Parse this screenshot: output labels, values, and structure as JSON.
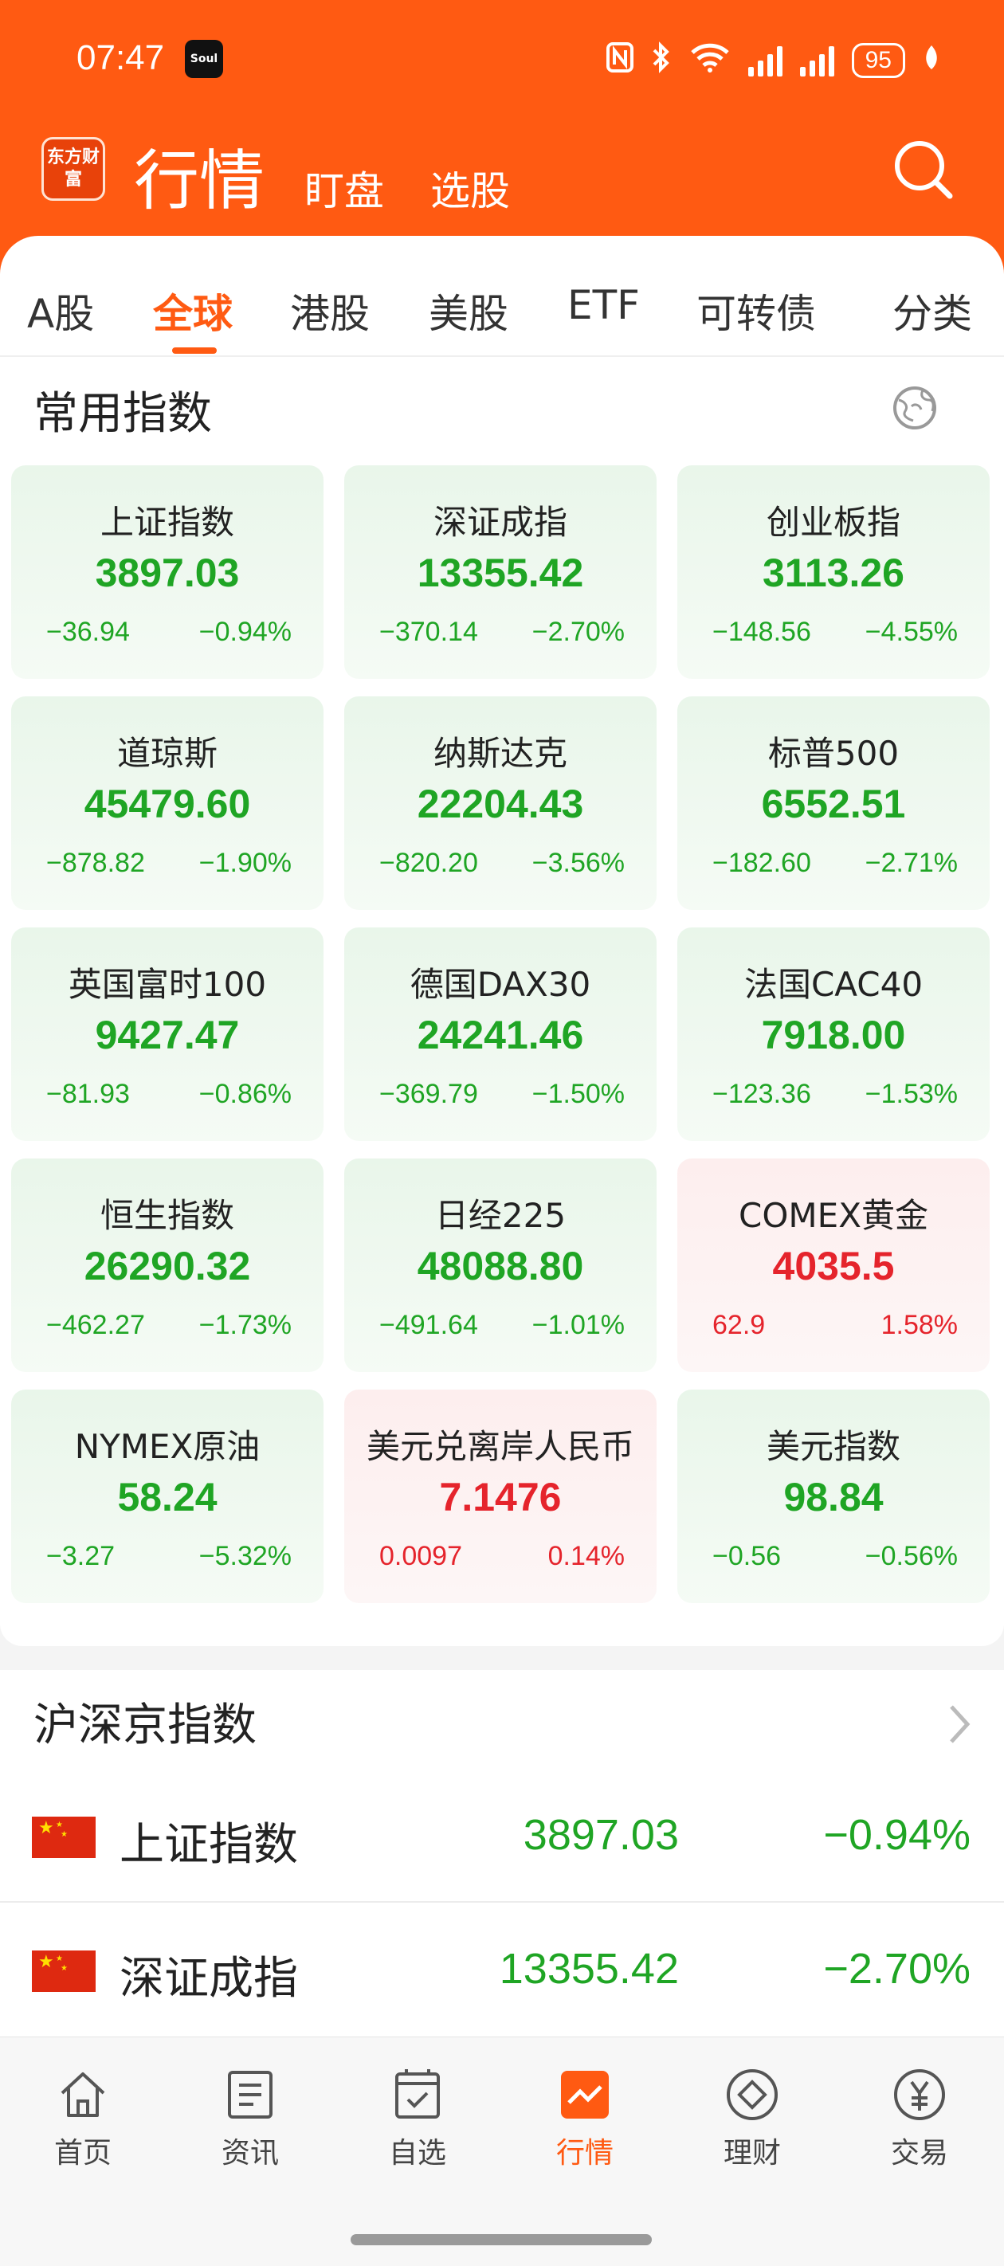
{
  "status_bar": {
    "time": "07:47",
    "app_icon": "Soul",
    "battery": "95",
    "icons": [
      "nfc-icon",
      "bluetooth-icon",
      "wifi-icon",
      "signal-icon",
      "signal-icon",
      "battery-icon",
      "leaf-icon"
    ]
  },
  "header": {
    "logo_text": "东方财富",
    "title": "行情",
    "nav": [
      "盯盘",
      "选股"
    ]
  },
  "tabs": [
    "A股",
    "全球",
    "港股",
    "美股",
    "ETF",
    "可转债",
    "分类"
  ],
  "active_tab": "全球",
  "common_indices": {
    "title": "常用指数",
    "cards": [
      {
        "name": "上证指数",
        "price": "3897.03",
        "change": "−36.94",
        "pct": "−0.94%",
        "trend": "down"
      },
      {
        "name": "深证成指",
        "price": "13355.42",
        "change": "−370.14",
        "pct": "−2.70%",
        "trend": "down"
      },
      {
        "name": "创业板指",
        "price": "3113.26",
        "change": "−148.56",
        "pct": "−4.55%",
        "trend": "down"
      },
      {
        "name": "道琼斯",
        "price": "45479.60",
        "change": "−878.82",
        "pct": "−1.90%",
        "trend": "down"
      },
      {
        "name": "纳斯达克",
        "price": "22204.43",
        "change": "−820.20",
        "pct": "−3.56%",
        "trend": "down"
      },
      {
        "name": "标普500",
        "price": "6552.51",
        "change": "−182.60",
        "pct": "−2.71%",
        "trend": "down"
      },
      {
        "name": "英国富时100",
        "price": "9427.47",
        "change": "−81.93",
        "pct": "−0.86%",
        "trend": "down"
      },
      {
        "name": "德国DAX30",
        "price": "24241.46",
        "change": "−369.79",
        "pct": "−1.50%",
        "trend": "down"
      },
      {
        "name": "法国CAC40",
        "price": "7918.00",
        "change": "−123.36",
        "pct": "−1.53%",
        "trend": "down"
      },
      {
        "name": "恒生指数",
        "price": "26290.32",
        "change": "−462.27",
        "pct": "−1.73%",
        "trend": "down"
      },
      {
        "name": "日经225",
        "price": "48088.80",
        "change": "−491.64",
        "pct": "−1.01%",
        "trend": "down"
      },
      {
        "name": "COMEX黄金",
        "price": "4035.5",
        "change": "62.9",
        "pct": "1.58%",
        "trend": "up"
      },
      {
        "name": "NYMEX原油",
        "price": "58.24",
        "change": "−3.27",
        "pct": "−5.32%",
        "trend": "down"
      },
      {
        "name": "美元兑离岸人民币",
        "price": "7.1476",
        "change": "0.0097",
        "pct": "0.14%",
        "trend": "up"
      },
      {
        "name": "美元指数",
        "price": "98.84",
        "change": "−0.56",
        "pct": "−0.56%",
        "trend": "down"
      }
    ]
  },
  "shsz_indices": {
    "title": "沪深京指数",
    "rows": [
      {
        "name": "上证指数",
        "price": "3897.03",
        "pct": "−0.94%"
      },
      {
        "name": "深证成指",
        "price": "13355.42",
        "pct": "−2.70%"
      }
    ]
  },
  "bottom_nav": [
    {
      "label": "首页",
      "icon": "home-icon"
    },
    {
      "label": "资讯",
      "icon": "news-icon"
    },
    {
      "label": "自选",
      "icon": "watchlist-icon"
    },
    {
      "label": "行情",
      "icon": "market-icon"
    },
    {
      "label": "理财",
      "icon": "wealth-icon"
    },
    {
      "label": "交易",
      "icon": "trade-icon"
    }
  ],
  "colors": {
    "brand": "#ff5a12",
    "up": "#e5242c",
    "down": "#1fa524"
  }
}
